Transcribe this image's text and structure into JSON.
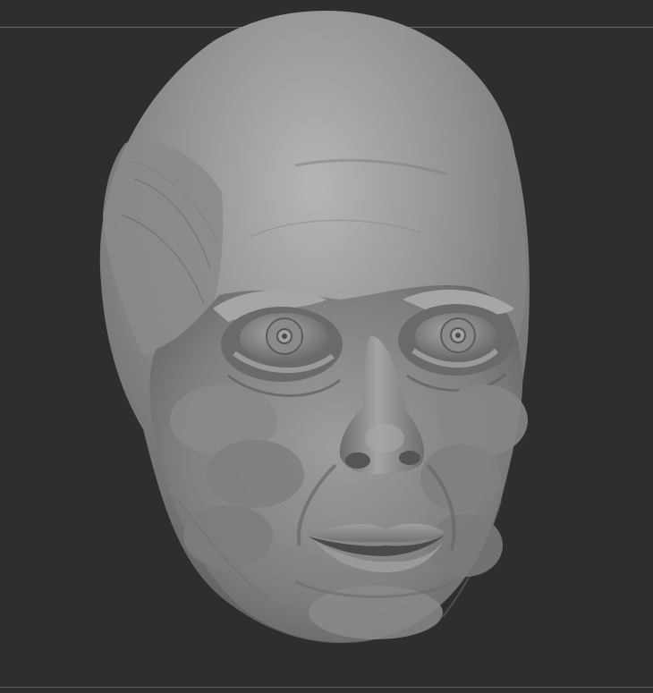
{
  "viewport": {
    "background_color": "#2e2e2e",
    "divider_color": "#6a6a6a"
  },
  "model": {
    "subject": "sculpted-head-mesh",
    "material_color": "#8c8c8c",
    "highlight_color": "#bdbdbd",
    "shadow_color": "#3c3c3c"
  }
}
